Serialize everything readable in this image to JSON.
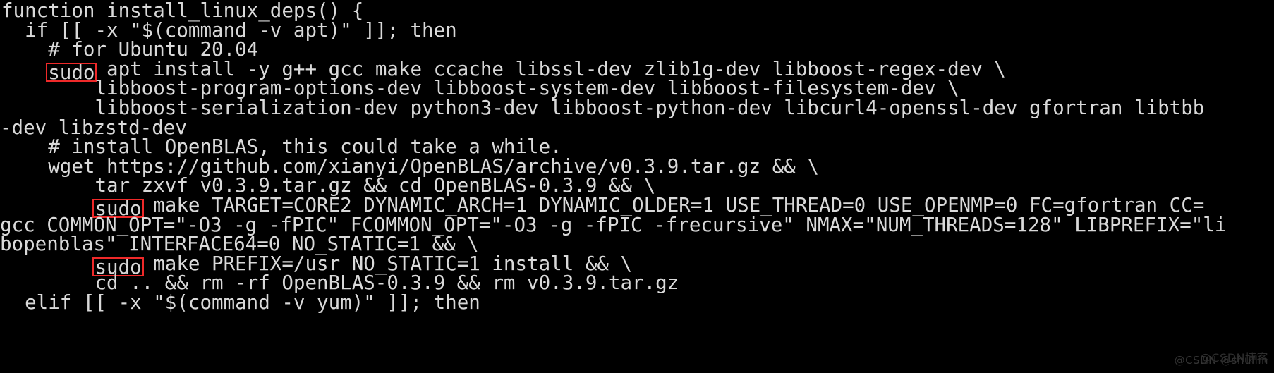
{
  "terminal": {
    "background_color": "#000000",
    "text_color": "#d9d9d9",
    "highlight_border_color": "#ef2929",
    "language": "bash",
    "lines": [
      {
        "id": "line-1",
        "segments": [
          {
            "type": "text",
            "text": "function install_linux_deps() {"
          }
        ]
      },
      {
        "id": "line-2",
        "segments": [
          {
            "type": "text",
            "text": "  if [[ -x \"$(command -v apt)\" ]]; then"
          }
        ]
      },
      {
        "id": "line-3",
        "segments": [
          {
            "type": "text",
            "text": "    # for Ubuntu 20.04"
          }
        ]
      },
      {
        "id": "line-4",
        "segments": [
          {
            "type": "text",
            "text": "    "
          },
          {
            "type": "highlight",
            "text": "sudo"
          },
          {
            "type": "text",
            "text": " apt install -y g++ gcc make ccache libssl-dev zlib1g-dev libboost-regex-dev \\"
          }
        ]
      },
      {
        "id": "line-5",
        "segments": [
          {
            "type": "text",
            "text": "        libboost-program-options-dev libboost-system-dev libboost-filesystem-dev \\"
          }
        ]
      },
      {
        "id": "line-6",
        "segments": [
          {
            "type": "text",
            "text": "        libboost-serialization-dev python3-dev libboost-python-dev libcurl4-openssl-dev gfortran libtbb"
          }
        ]
      },
      {
        "id": "line-6-wrap",
        "wrapped": true,
        "segments": [
          {
            "type": "text",
            "text": "-dev libzstd-dev"
          }
        ]
      },
      {
        "id": "line-7",
        "segments": [
          {
            "type": "text",
            "text": "    # install OpenBLAS, this could take a while."
          }
        ]
      },
      {
        "id": "line-8",
        "segments": [
          {
            "type": "text",
            "text": "    wget https://github.com/xianyi/OpenBLAS/archive/v0.3.9.tar.gz && \\"
          }
        ]
      },
      {
        "id": "line-9",
        "segments": [
          {
            "type": "text",
            "text": "        tar zxvf v0.3.9.tar.gz && cd OpenBLAS-0.3.9 && \\"
          }
        ]
      },
      {
        "id": "line-10",
        "segments": [
          {
            "type": "text",
            "text": "        "
          },
          {
            "type": "highlight",
            "text": "sudo"
          },
          {
            "type": "text",
            "text": " make TARGET=CORE2 DYNAMIC_ARCH=1 DYNAMIC_OLDER=1 USE_THREAD=0 USE_OPENMP=0 FC=gfortran CC="
          }
        ]
      },
      {
        "id": "line-10-wrap-1",
        "wrapped": true,
        "segments": [
          {
            "type": "text",
            "text": "gcc COMMON_OPT=\"-O3 -g -fPIC\" FCOMMON_OPT=\"-O3 -g -fPIC -frecursive\" NMAX=\"NUM_THREADS=128\" LIBPREFIX=\"li"
          }
        ]
      },
      {
        "id": "line-10-wrap-2",
        "wrapped": true,
        "segments": [
          {
            "type": "text",
            "text": "bopenblas\" INTERFACE64=0 NO_STATIC=1 && \\"
          }
        ]
      },
      {
        "id": "line-11",
        "segments": [
          {
            "type": "text",
            "text": "        "
          },
          {
            "type": "highlight",
            "text": "sudo"
          },
          {
            "type": "text",
            "text": " make PREFIX=/usr NO_STATIC=1 install && \\"
          }
        ]
      },
      {
        "id": "line-12",
        "segments": [
          {
            "type": "text",
            "text": "        cd .. && rm -rf OpenBLAS-0.3.9 && rm v0.3.9.tar.gz"
          }
        ]
      },
      {
        "id": "line-13",
        "segments": [
          {
            "type": "text",
            "text": "  elif [[ -x \"$(command -v yum)\" ]]; then"
          }
        ]
      }
    ]
  },
  "watermark": {
    "front_text": "@CSDN @shuilin",
    "back_text": "@CSDN博客"
  }
}
